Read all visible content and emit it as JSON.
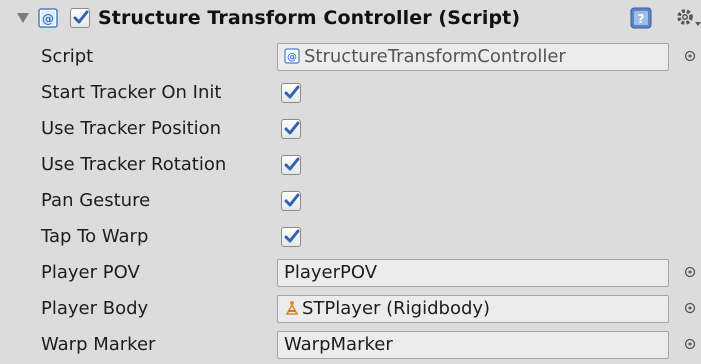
{
  "component": {
    "title": "Structure Transform Controller (Script)",
    "enabled": true
  },
  "properties": [
    {
      "label": "Script",
      "type": "object",
      "value": "StructureTransformController",
      "icon": "script-icon"
    },
    {
      "label": "Start Tracker On Init",
      "type": "checkbox",
      "checked": true
    },
    {
      "label": "Use Tracker Position",
      "type": "checkbox",
      "checked": true
    },
    {
      "label": "Use Tracker Rotation",
      "type": "checkbox",
      "checked": true
    },
    {
      "label": "Pan Gesture",
      "type": "checkbox",
      "checked": true
    },
    {
      "label": "Tap To Warp",
      "type": "checkbox",
      "checked": true
    },
    {
      "label": "Player POV",
      "type": "object",
      "value": "PlayerPOV"
    },
    {
      "label": "Player Body",
      "type": "object",
      "value": "STPlayer (Rigidbody)",
      "icon": "rigidbody-icon"
    },
    {
      "label": "Warp Marker",
      "type": "object",
      "value": "WarpMarker"
    }
  ],
  "colors": {
    "background": "#dcdcdc",
    "check": "#2f63b5",
    "field": "#ececec"
  }
}
